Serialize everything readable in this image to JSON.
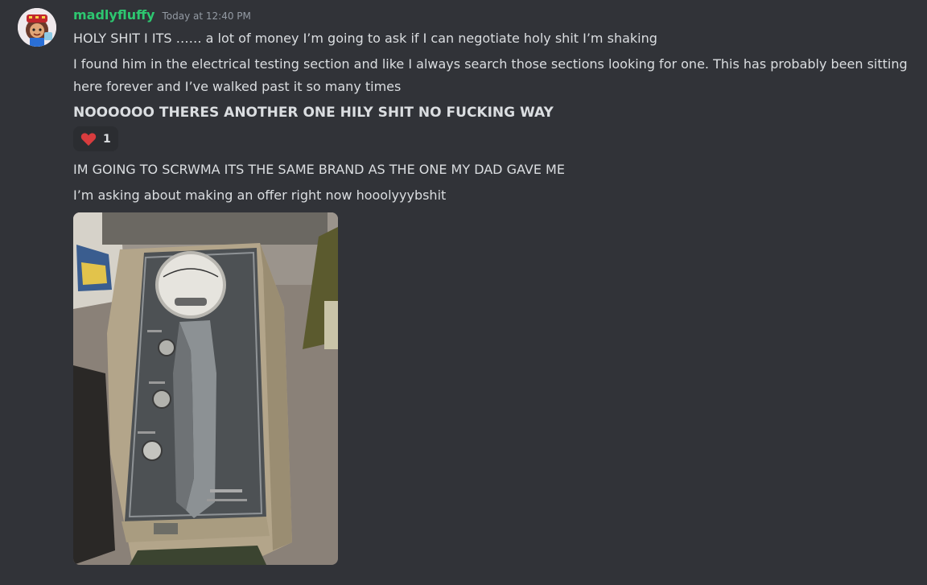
{
  "author": {
    "username": "madlyfluffy",
    "timestamp": "Today at 12:40 PM",
    "color": "#2dc770"
  },
  "messages": [
    "HOLY SHIT I ITS …… a lot of money I’m going to ask if I can negotiate holy shit I’m shaking",
    "I found him in the electrical testing section and like I always search those sections looking for one. This has probably been sitting here forever and I’ve walked past it so many times",
    "NOOOOOO THERES ANOTHER ONE HILY SHIT NO FUCKING WAY",
    "IM GOING TO SCRWMA ITS THE SAME BRAND AS THE ONE MY DAD GAVE ME",
    "I’m asking about making an offer right now hooolyyybshit"
  ],
  "reaction": {
    "emoji": "heart-icon",
    "count": "1",
    "color": "#d83c3e"
  },
  "attachment": {
    "type": "image",
    "description_icon": "photo-attachment"
  }
}
